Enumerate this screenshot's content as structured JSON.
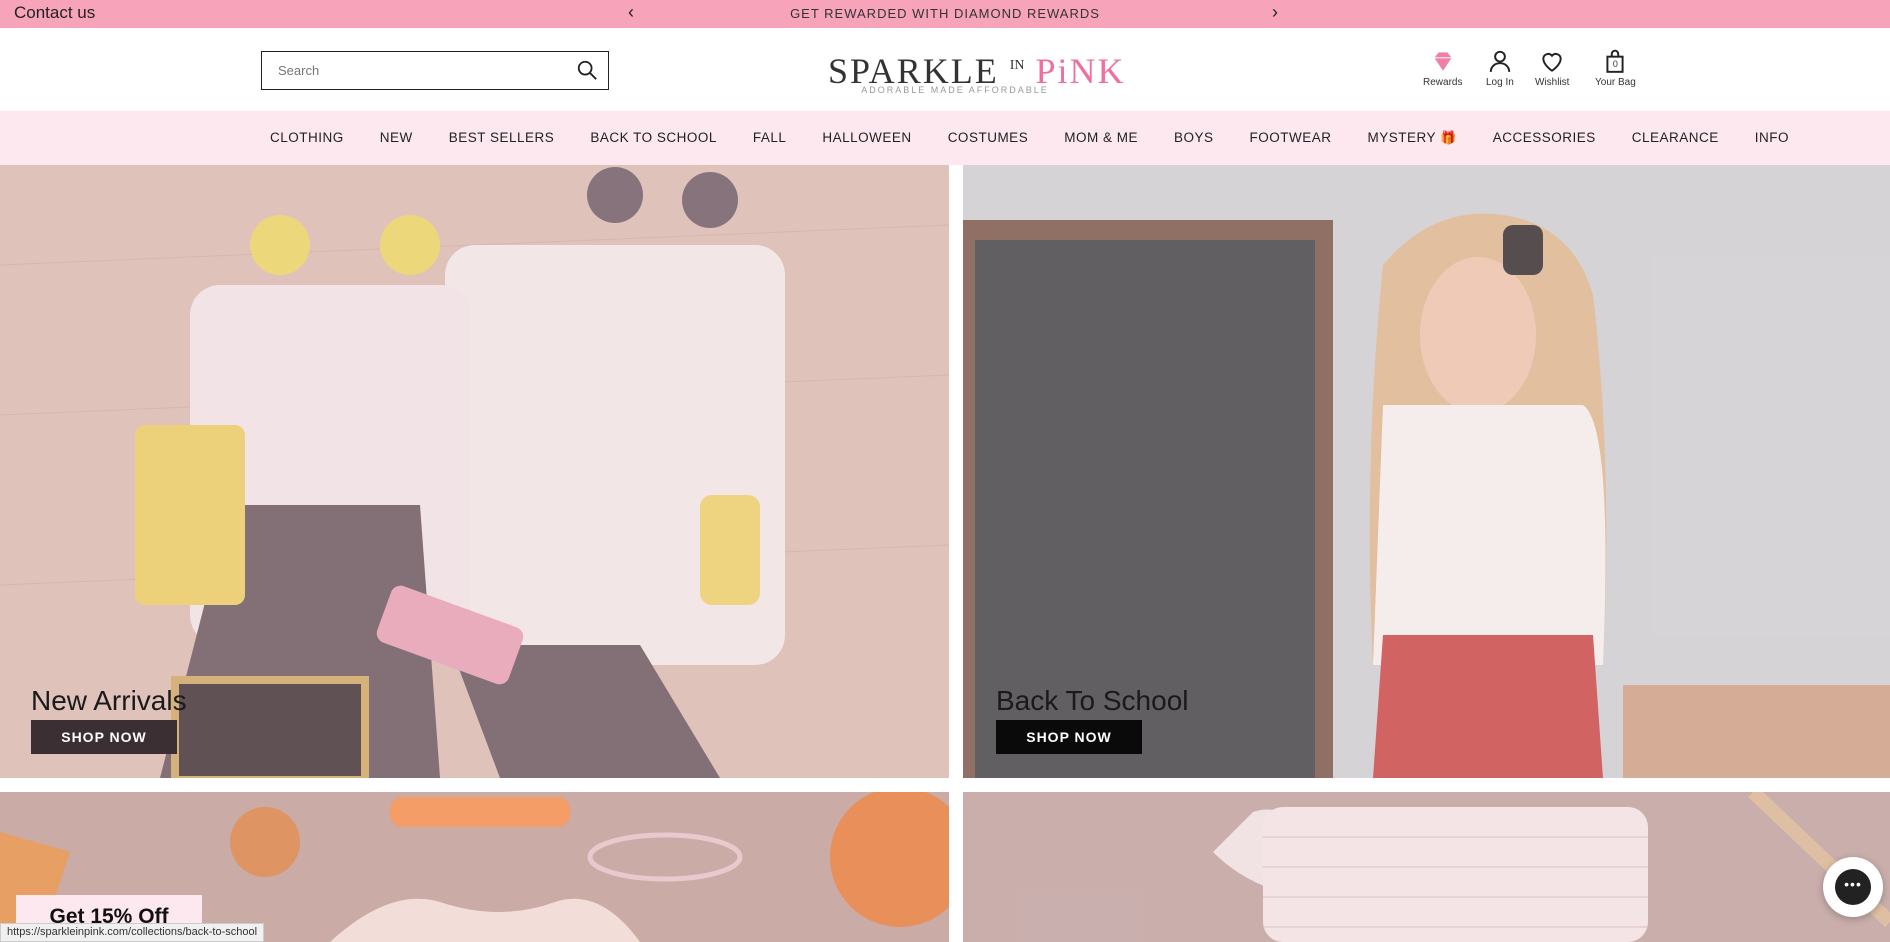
{
  "topbar": {
    "contact": "Contact us",
    "promo": "GET REWARDED WITH DIAMOND REWARDS",
    "prev_icon": "chevron-left-icon",
    "next_icon": "chevron-right-icon"
  },
  "header": {
    "search_placeholder": "Search",
    "logo_text_a": "SPARKLE",
    "logo_text_in": "IN",
    "logo_text_b": "PiNK",
    "logo_tagline": "ADORABLE MADE AFFORDABLE",
    "rewards_label": "Rewards",
    "login_label": "Log In",
    "wishlist_label": "Wishlist",
    "bag_label": "Your Bag",
    "bag_count": "0"
  },
  "nav": {
    "items": [
      {
        "label": "CLOTHING"
      },
      {
        "label": "NEW"
      },
      {
        "label": "BEST SELLERS"
      },
      {
        "label": "BACK TO SCHOOL"
      },
      {
        "label": "FALL"
      },
      {
        "label": "HALLOWEEN"
      },
      {
        "label": "COSTUMES"
      },
      {
        "label": "MOM & ME"
      },
      {
        "label": "BOYS"
      },
      {
        "label": "FOOTWEAR"
      },
      {
        "label": "MYSTERY"
      },
      {
        "label": "ACCESSORIES"
      },
      {
        "label": "CLEARANCE"
      },
      {
        "label": "INFO"
      }
    ]
  },
  "tiles": {
    "new_arrivals": {
      "title": "New Arrivals",
      "button": "SHOP NOW"
    },
    "back_to_school": {
      "title": "Back To School",
      "button": "SHOP NOW"
    }
  },
  "footer": {
    "promo_tab": "Get 15% Off",
    "status_url": "https://sparkleinpink.com/collections/back-to-school"
  },
  "colors": {
    "topbar": "#f7a4bb",
    "nav": "#fde8ef",
    "brand_pink": "#f06fa0"
  }
}
